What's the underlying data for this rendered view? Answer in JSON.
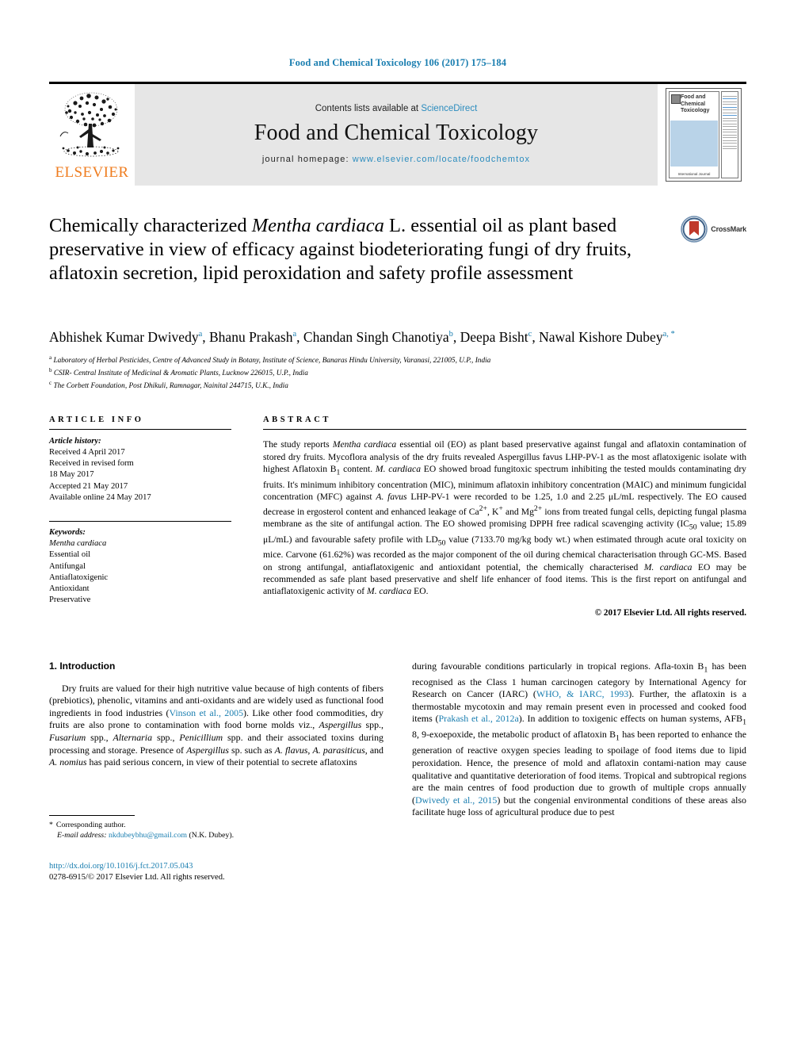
{
  "running_head": "Food and Chemical Toxicology 106 (2017) 175–184",
  "masthead": {
    "contents_prefix": "Contents lists available at ",
    "sciencedirect": "ScienceDirect",
    "journal_name": "Food and Chemical Toxicology",
    "homepage_prefix": "journal homepage: ",
    "homepage_url": "www.elsevier.com/locate/foodchemtox",
    "publisher": "ELSEVIER",
    "cover_title": "Food and Chemical Toxicology",
    "cover_footer": "International Journal",
    "link_color": "#2b8cbe",
    "band_color": "#e6e6e6",
    "publisher_color": "#ef7d20"
  },
  "article": {
    "title_part1": "Chemically characterized ",
    "title_italic": "Mentha cardiaca",
    "title_part2": " L. essential oil as plant based preservative in view of efficacy against biodeteriorating fungi of dry fruits, aflatoxin secretion, lipid peroxidation and safety profile assessment",
    "crossmark_label": "CrossMark",
    "authors": [
      {
        "name": "Abhishek Kumar Dwivedy",
        "marks": "a",
        "sep": ", "
      },
      {
        "name": "Bhanu Prakash",
        "marks": "a",
        "sep": ", "
      },
      {
        "name": "Chandan Singh Chanotiya",
        "marks": "b",
        "sep": ", "
      },
      {
        "name": "Deepa Bisht",
        "marks": "c",
        "sep": ", "
      },
      {
        "name": "Nawal Kishore Dubey",
        "marks": "a, *",
        "sep": ""
      }
    ],
    "affiliations": [
      {
        "mark": "a",
        "text": "Laboratory of Herbal Pesticides, Centre of Advanced Study in Botany, Institute of Science, Banaras Hindu University, Varanasi, 221005, U.P., India"
      },
      {
        "mark": "b",
        "text": "CSIR- Central Institute of Medicinal & Aromatic Plants, Lucknow 226015, U.P., India"
      },
      {
        "mark": "c",
        "text": "The Corbett Foundation, Post Dhikuli, Ramnagar, Nainital 244715, U.K., India"
      }
    ]
  },
  "article_info": {
    "heading": "ARTICLE INFO",
    "history_label": "Article history:",
    "history": [
      "Received 4 April 2017",
      "Received in revised form",
      "18 May 2017",
      "Accepted 21 May 2017",
      "Available online 24 May 2017"
    ],
    "keywords_label": "Keywords:",
    "keywords": [
      "Mentha cardiaca",
      "Essential oil",
      "Antifungal",
      "Antiaflatoxigenic",
      "Antioxidant",
      "Preservative"
    ]
  },
  "abstract": {
    "heading": "ABSTRACT",
    "p1_a": "The study reports ",
    "p1_it1": "Mentha cardiaca",
    "p1_b": " essential oil (EO) as plant based preservative against fungal and aflatoxin contamination of stored dry fruits. Mycoflora analysis of the dry fruits revealed Aspergillus favus LHP-PV-1 as the most aflatoxigenic isolate with highest Aflatoxin B",
    "p1_sub1": "1",
    "p1_c": " content. ",
    "p1_it2": "M. cardiaca",
    "p1_d": " EO showed broad fungitoxic spectrum inhibiting the tested moulds contaminating dry fruits. It's minimum inhibitory concentration (MIC), minimum aflatoxin inhibitory concentration (MAIC) and minimum fungicidal concentration (MFC) against ",
    "p1_it3": "A. favus",
    "p1_e": " LHP-PV-1 were recorded to be 1.25, 1.0 and 2.25 μL/mL respectively. The EO caused decrease in ergosterol content and enhanced leakage of Ca",
    "p1_sup1": "2+",
    "p1_f": ", K",
    "p1_sup2": "+",
    "p1_g": " and Mg",
    "p1_sup3": "2+",
    "p1_h": " ions from treated fungal cells, depicting fungal plasma membrane as the site of antifungal action. The EO showed promising DPPH free radical scavenging activity (IC",
    "p1_sub2": "50",
    "p1_i": " value; 15.89 μL/mL) and favourable safety profile with LD",
    "p1_sub3": "50",
    "p1_j": " value (7133.70 mg/kg body wt.) when estimated through acute oral toxicity on mice. Carvone (61.62%) was recorded as the major component of the oil during chemical characterisation through GC-MS. Based on strong antifungal, antiaflatoxigenic and antioxidant potential, the chemically characterised ",
    "p1_it4": "M. cardiaca",
    "p1_k": " EO may be recommended as safe plant based preservative and shelf life enhancer of food items. This is the first report on antifungal and antiaflatoxigenic activity of ",
    "p1_it5": "M. cardiaca",
    "p1_l": " EO.",
    "copyright": "© 2017 Elsevier Ltd. All rights reserved."
  },
  "introduction": {
    "heading": "1. Introduction",
    "left_a": "Dry fruits are valued for their high nutritive value because of high contents of fibers (prebiotics), phenolic, vitamins and anti-oxidants and are widely used as functional food ingredients in food industries (",
    "left_cite1": "Vinson et al., 2005",
    "left_b": "). Like other food commodities, dry fruits are also prone to contamination with food borne molds viz., ",
    "left_it1": "Aspergillus",
    "left_c": " spp., ",
    "left_it2": "Fusarium",
    "left_d": " spp., ",
    "left_it3": "Alternaria",
    "left_e": " spp., ",
    "left_it4": "Penicillium",
    "left_f": " spp. and their associated toxins during processing and storage. Presence of ",
    "left_it5": "Aspergillus",
    "left_g": " sp. such as ",
    "left_it6": "A. flavus",
    "left_h": ", ",
    "left_it7": "A. parasiticus",
    "left_i": ", and ",
    "left_it8": "A. nomius",
    "left_j": " has paid serious concern, in view of their potential to secrete aflatoxins",
    "right_a": "during favourable conditions particularly in tropical regions. Afla-toxin B",
    "right_sub1": "1",
    "right_b": " has been recognised as the Class 1 human carcinogen category by International Agency for Research on Cancer (IARC) (",
    "right_cite1": "WHO, & IARC, 1993",
    "right_c": "). Further, the aflatoxin is a thermostable mycotoxin and may remain present even in processed and cooked food items (",
    "right_cite2": "Prakash et al., 2012a",
    "right_d": "). In addition to toxigenic effects on human systems, AFB",
    "right_sub2": "1",
    "right_e": " 8, 9-exoepoxide, the metabolic product of aflatoxin B",
    "right_sub3": "1",
    "right_f": " has been reported to enhance the generation of reactive oxygen species leading to spoilage of food items due to lipid peroxidation. Hence, the presence of mold and aflatoxin contami-nation may cause qualitative and quantitative deterioration of food items. Tropical and subtropical regions are the main centres of food production due to growth of multiple crops annually (",
    "right_cite3": "Dwivedy et al., 2015",
    "right_g": ") but the congenial environmental conditions of these areas also facilitate huge loss of agricultural produce due to pest"
  },
  "footer": {
    "corresponding_label": "Corresponding author.",
    "email_label": "E-mail address:",
    "email": "nkdubeybhu@gmail.com",
    "email_owner": "(N.K. Dubey).",
    "doi": "http://dx.doi.org/10.1016/j.fct.2017.05.043",
    "issn_line": "0278-6915/© 2017 Elsevier Ltd. All rights reserved."
  }
}
